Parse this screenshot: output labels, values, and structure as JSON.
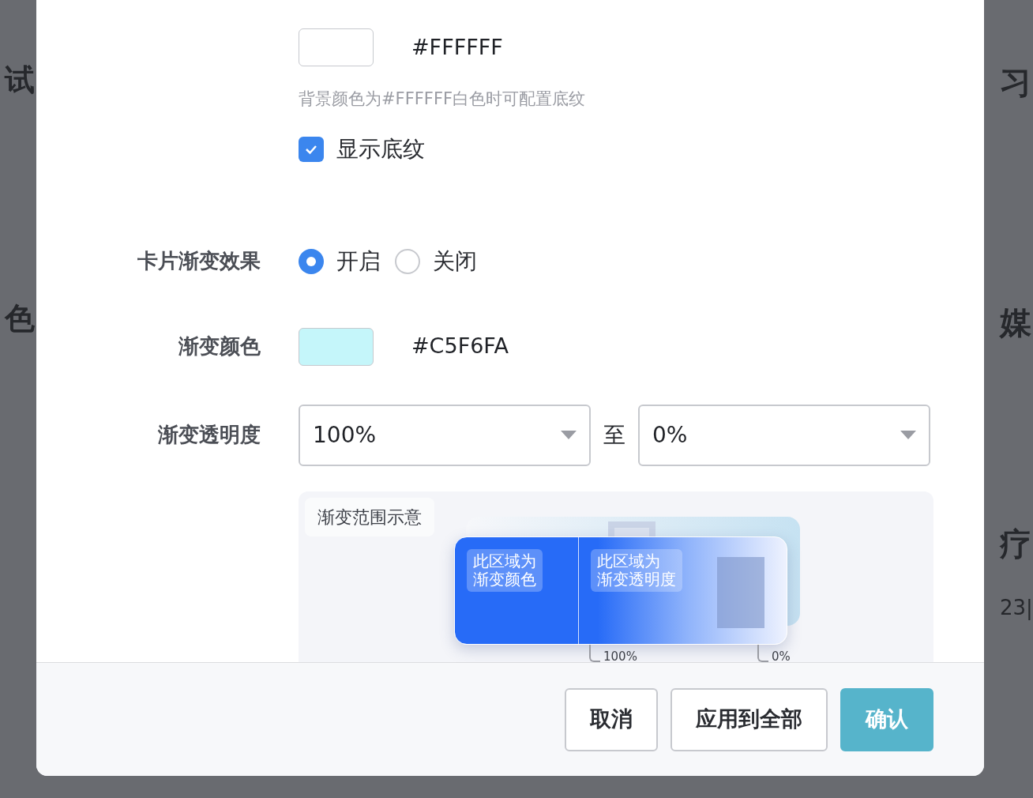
{
  "background": {
    "left": [
      "试",
      "色"
    ],
    "right": [
      "习",
      "媒",
      "疗",
      "23|"
    ]
  },
  "pattern": {
    "color": "#ffffff",
    "value": "#FFFFFF",
    "hint": "背景颜色为#FFFFFF白色时可配置底纹",
    "checkbox": {
      "label": "显示底纹",
      "checked": true
    }
  },
  "gradient_effect": {
    "label": "卡片渐变效果",
    "options": [
      {
        "label": "开启",
        "selected": true
      },
      {
        "label": "关闭",
        "selected": false
      }
    ]
  },
  "gradient_color": {
    "label": "渐变颜色",
    "color": "#c5f6fa",
    "value": "#C5F6FA"
  },
  "gradient_opacity": {
    "label": "渐变透明度",
    "from": "100%",
    "separator": "至",
    "to": "0%"
  },
  "preview": {
    "title": "渐变范围示意",
    "color_area": [
      "此区域为",
      "渐变颜色"
    ],
    "opacity_area": [
      "此区域为",
      "渐变透明度"
    ],
    "start_label": "100%",
    "end_label": "0%"
  },
  "buttons": [
    {
      "label": "取消",
      "kind": "default"
    },
    {
      "label": "应用到全部",
      "kind": "default"
    },
    {
      "label": "确认",
      "kind": "primary"
    }
  ]
}
